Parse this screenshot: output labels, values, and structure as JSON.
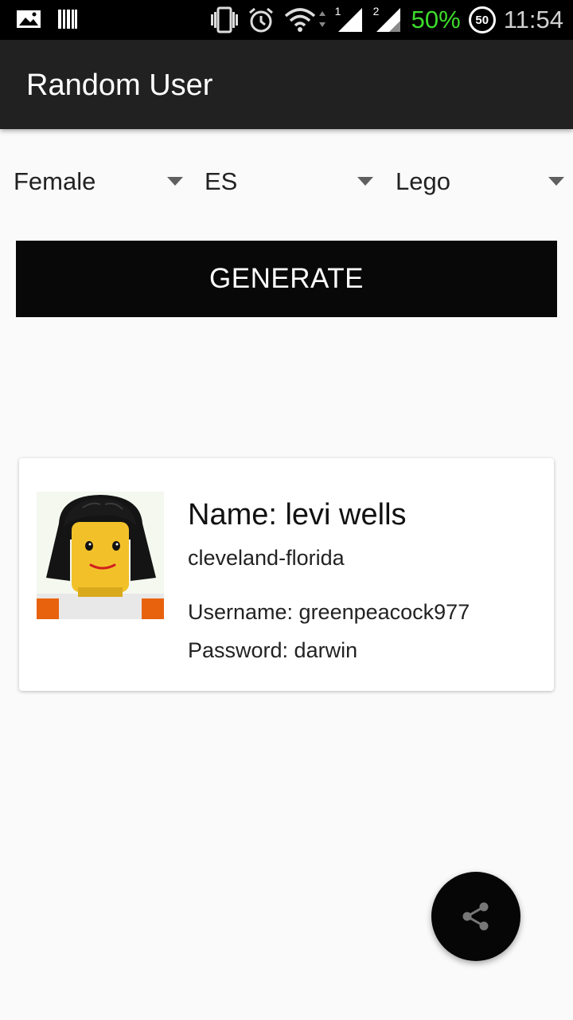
{
  "status_bar": {
    "battery_percent": "50%",
    "battery_badge": "50",
    "time": "11:54",
    "sim1": "1",
    "sim2": "2",
    "icons": [
      "image-icon",
      "barcode-icon",
      "vibrate-icon",
      "alarm-icon",
      "wifi-icon",
      "signal-icon",
      "signal-icon",
      "battery-icon"
    ],
    "battery_color": "#3ddc2c"
  },
  "app_bar": {
    "title": "Random User"
  },
  "filters": {
    "gender": "Female",
    "nationality": "ES",
    "style": "Lego"
  },
  "actions": {
    "generate_label": "GENERATE"
  },
  "user_card": {
    "name": "Name: levi wells",
    "location": "cleveland-florida",
    "username": "Username: greenpeacock977",
    "password": "Password: darwin",
    "avatar_icon": "lego-minifigure-avatar"
  },
  "fab": {
    "icon": "share-icon"
  }
}
